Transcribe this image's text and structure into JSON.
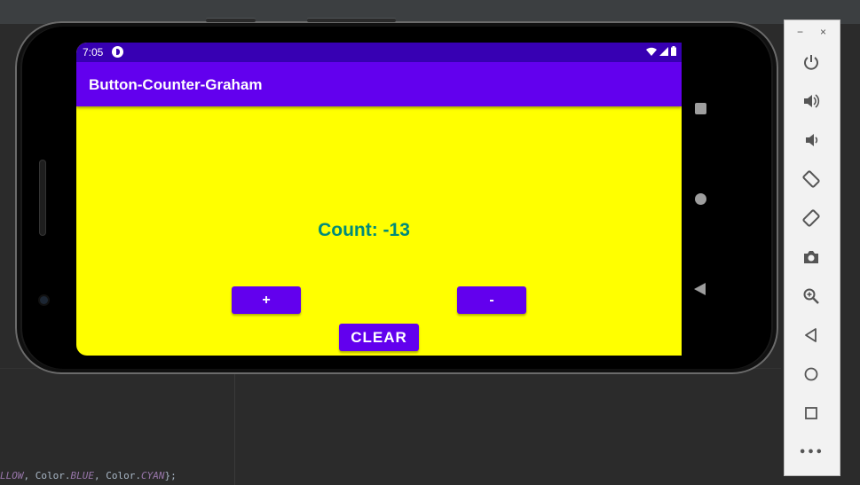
{
  "app": {
    "title": "Button-Counter-Graham",
    "count_text": "Count: -13",
    "buttons": {
      "plus": "+",
      "minus": "-",
      "clear": "CLEAR"
    }
  },
  "statusbar": {
    "time": "7:05"
  },
  "code_snippet": {
    "prefix": "LLOW",
    "sep1": ", Color.",
    "blue": "BLUE",
    "sep2": ", Color.",
    "cyan": "CYAN",
    "suffix": "};"
  },
  "emulator_toolbar": {
    "window_controls": [
      "−",
      "×"
    ],
    "items": [
      "power",
      "volume-up",
      "volume-down",
      "rotate-left",
      "rotate-right",
      "screenshot",
      "zoom",
      "back",
      "home",
      "overview",
      "more"
    ],
    "more_label": "•••"
  },
  "colors": {
    "screen_background": "#ffff00",
    "app_bar": "#6200ee",
    "status_bar": "#3700b3",
    "count_text": "#008b7a",
    "button": "#6200ee"
  }
}
